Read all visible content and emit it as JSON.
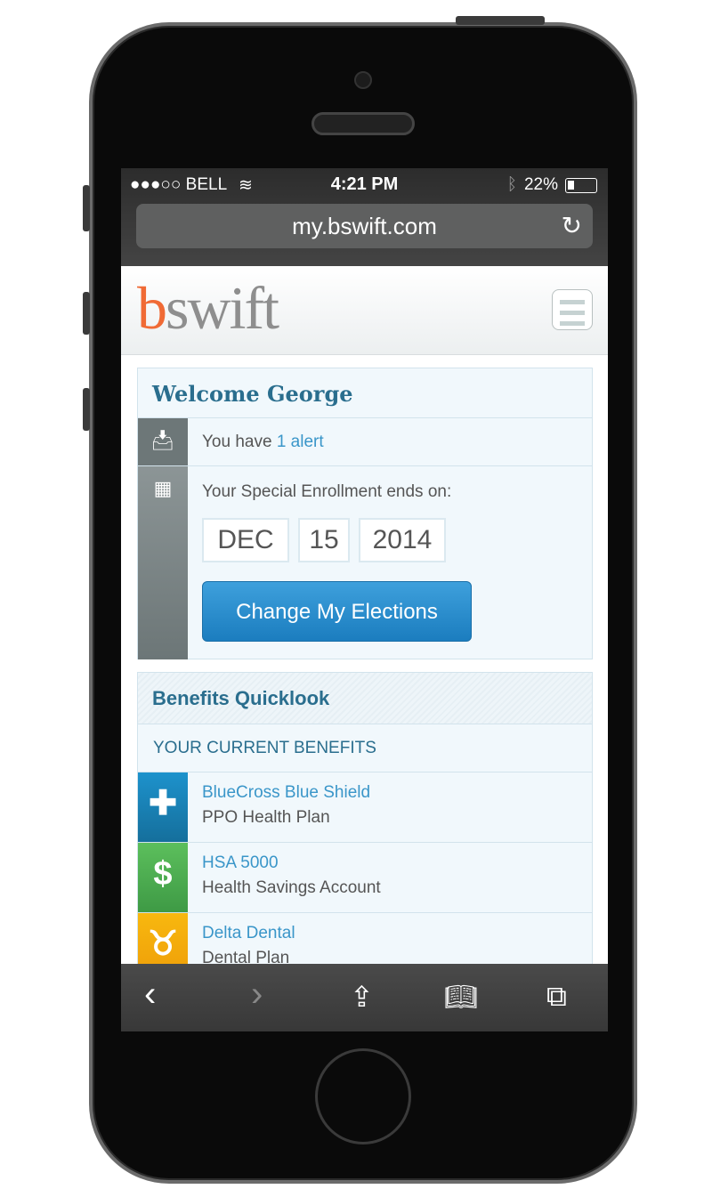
{
  "status_bar": {
    "carrier": "●●●○○ BELL",
    "time": "4:21 PM",
    "battery": "22%",
    "battery_level": 0.22
  },
  "browser": {
    "url": "my.bswift.com"
  },
  "header": {
    "logo_b": "b",
    "logo_rest": "swift"
  },
  "welcome": {
    "title": "Welcome George",
    "alert_prefix": "You have ",
    "alert_link": "1 alert",
    "enrollment_text": "Your Special Enrollment ends on:",
    "date": {
      "month": "DEC",
      "day": "15",
      "year": "2014"
    },
    "cta": "Change My Elections"
  },
  "benefits": {
    "title": "Benefits Quicklook",
    "subtitle": "YOUR CURRENT BENEFITS",
    "items": [
      {
        "name": "BlueCross Blue Shield",
        "desc": "PPO Health Plan",
        "icon": "cross-icon",
        "color": "#1a85bd"
      },
      {
        "name": "HSA 5000",
        "desc": "Health Savings Account",
        "icon": "dollar-icon",
        "color": "#4faa4f"
      },
      {
        "name": "Delta Dental",
        "desc": "Dental Plan",
        "icon": "tooth-icon",
        "color": "#f3a90c"
      }
    ]
  }
}
